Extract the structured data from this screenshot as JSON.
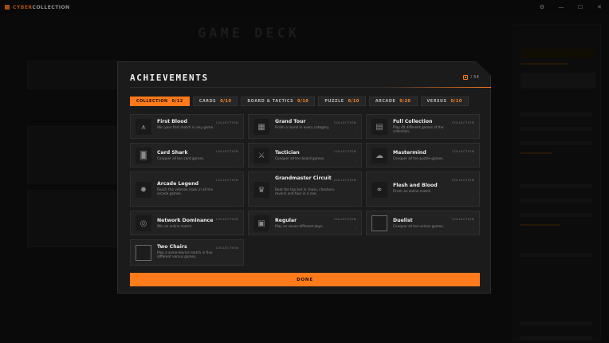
{
  "app": {
    "name_prefix": "CYBER",
    "name_suffix": "COLLECTION",
    "window_controls": [
      "⚙",
      "—",
      "☐",
      "✕"
    ]
  },
  "background": {
    "title": "GAME DECK"
  },
  "modal": {
    "title": "ACHIEVEMENTS",
    "progress": "/ 54",
    "done_label": "DONE"
  },
  "tabs": [
    {
      "label": "COLLECTION",
      "count": "0/12"
    },
    {
      "label": "CARDS",
      "count": "0/10"
    },
    {
      "label": "BOARD & TACTICS",
      "count": "0/10"
    },
    {
      "label": "PUZZLE",
      "count": "0/10"
    },
    {
      "label": "ARCADE",
      "count": "0/20"
    },
    {
      "label": "VERSUS",
      "count": "0/10"
    }
  ],
  "achievements": [
    {
      "title": "First Blood",
      "desc": "Win your first match in any game.",
      "tag": "COLLECTION",
      "icon": "sword-chevron-icon"
    },
    {
      "title": "Grand Tour",
      "desc": "Finish a round in every category.",
      "tag": "COLLECTION",
      "icon": "map-grid-icon"
    },
    {
      "title": "Full Collection",
      "desc": "Play 40 different games of the collection.",
      "tag": "COLLECTION",
      "icon": "cabinet-icon"
    },
    {
      "title": "Card Shark",
      "desc": "Conquer all ten card games.",
      "tag": "COLLECTION",
      "icon": "cards-icon"
    },
    {
      "title": "Tactician",
      "desc": "Conquer all ten board games.",
      "tag": "COLLECTION",
      "icon": "crossed-swords-icon"
    },
    {
      "title": "Mastermind",
      "desc": "Conquer all ten puzzle games.",
      "tag": "COLLECTION",
      "icon": "brain-icon"
    },
    {
      "title": "Arcade Legend",
      "desc": "Reach the veteran mark in all ten arcade games.",
      "tag": "COLLECTION",
      "icon": "joystick-icon"
    },
    {
      "title": "Grandmaster Circuit",
      "desc": "Beat the top bot in chess, checkers, reversi and four in a row.",
      "tag": "COLLECTION",
      "icon": "crown-icon"
    },
    {
      "title": "Flesh and Blood",
      "desc": "Finish an online match.",
      "tag": "COLLECTION",
      "icon": "network-icon"
    },
    {
      "title": "Network Dominance",
      "desc": "Win an online match.",
      "tag": "COLLECTION",
      "icon": "globe-icon"
    },
    {
      "title": "Regular",
      "desc": "Play on seven different days.",
      "tag": "COLLECTION",
      "icon": "calendar-icon"
    },
    {
      "title": "Duelist",
      "desc": "Conquer all ten versus games.",
      "tag": "COLLECTION",
      "icon": "blank-icon"
    },
    {
      "title": "Two Chairs",
      "desc": "Play a same-device match in five different versus games.",
      "tag": "COLLECTION",
      "icon": "blank-icon"
    }
  ],
  "colors": {
    "accent": "#ff7a1a",
    "modal_bg": "#1b1b1b",
    "card_bg": "#222222"
  }
}
